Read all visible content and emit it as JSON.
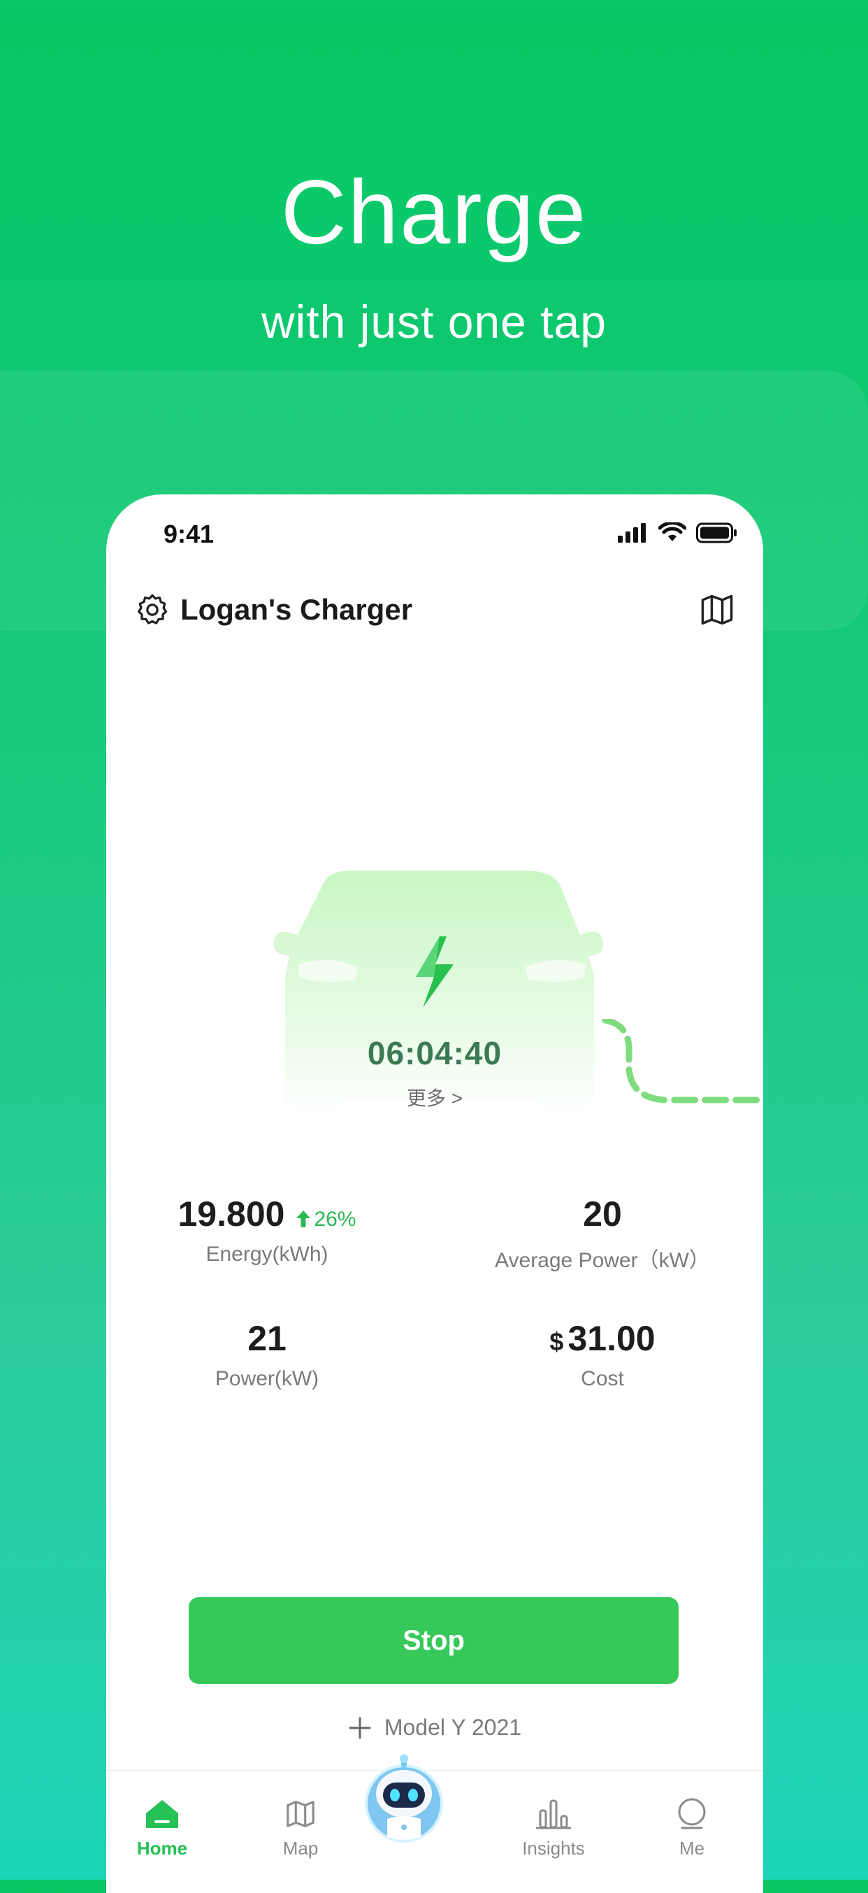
{
  "promo": {
    "title": "Charge",
    "subtitle": "with just one tap"
  },
  "status_bar": {
    "time": "9:41"
  },
  "header": {
    "title": "Logan's Charger"
  },
  "session": {
    "timer": "06:04:40",
    "more_label": "更多 >"
  },
  "stats": {
    "energy": {
      "value": "19.800",
      "delta": "26%",
      "label": "Energy(kWh)"
    },
    "avg_power": {
      "value": "20",
      "label": "Average Power（kW）"
    },
    "power": {
      "value": "21",
      "label": "Power(kW)"
    },
    "cost": {
      "currency": "$",
      "value": "31.00",
      "label": "Cost"
    }
  },
  "actions": {
    "stop_label": "Stop",
    "add_vehicle_label": "Model Y 2021"
  },
  "tabbar": {
    "items": [
      {
        "label": "Home",
        "icon": "home-icon",
        "active": true
      },
      {
        "label": "Map",
        "icon": "map-icon",
        "active": false
      },
      {
        "label": "",
        "icon": "robot-assistant-icon",
        "active": false
      },
      {
        "label": "Insights",
        "icon": "bar-chart-icon",
        "active": false
      },
      {
        "label": "Me",
        "icon": "profile-icon",
        "active": false
      }
    ]
  },
  "colors": {
    "brand_green": "#37c85a",
    "accent_green": "#27c255",
    "background_top": "#07c865",
    "background_bottom": "#1dd4b8"
  }
}
